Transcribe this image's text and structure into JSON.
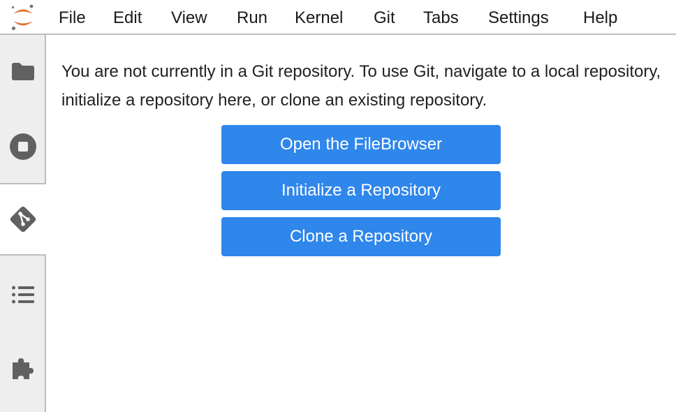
{
  "menubar": {
    "logo_icon": "jupyter-logo-icon",
    "items": [
      "File",
      "Edit",
      "View",
      "Run",
      "Kernel",
      "Git",
      "Tabs",
      "Settings",
      "Help"
    ]
  },
  "sidebar": {
    "tabs": [
      {
        "icon": "folder-icon",
        "active": false
      },
      {
        "icon": "running-stop-icon",
        "active": false
      },
      {
        "icon": "git-icon",
        "active": true
      },
      {
        "icon": "table-of-contents-icon",
        "active": false
      },
      {
        "icon": "extension-puzzle-icon",
        "active": false
      }
    ]
  },
  "git_panel": {
    "message": "You are not currently in a Git repository. To use Git, navigate to a local repository, initialize a repository here, or clone an existing repository.",
    "buttons": {
      "open_filebrowser": "Open the FileBrowser",
      "initialize": "Initialize a Repository",
      "clone": "Clone a Repository"
    }
  },
  "colors": {
    "button_bg": "#2f86eb",
    "sidebar_bg": "#eeeeee",
    "icon_gray": "#616161",
    "logo_orange": "#e46e2e"
  }
}
